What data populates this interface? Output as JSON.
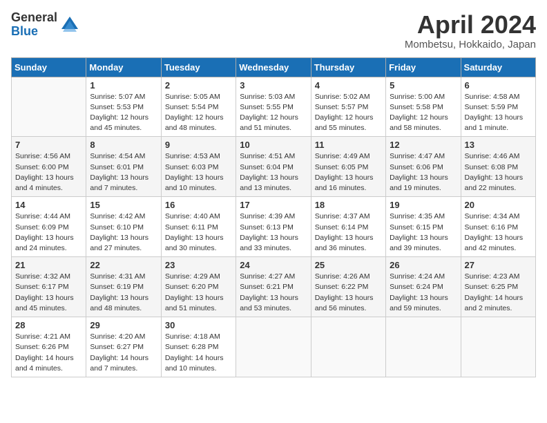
{
  "header": {
    "logo_general": "General",
    "logo_blue": "Blue",
    "month_title": "April 2024",
    "location": "Mombetsu, Hokkaido, Japan"
  },
  "calendar": {
    "days_of_week": [
      "Sunday",
      "Monday",
      "Tuesday",
      "Wednesday",
      "Thursday",
      "Friday",
      "Saturday"
    ],
    "weeks": [
      [
        {
          "day": "",
          "info": ""
        },
        {
          "day": "1",
          "info": "Sunrise: 5:07 AM\nSunset: 5:53 PM\nDaylight: 12 hours\nand 45 minutes."
        },
        {
          "day": "2",
          "info": "Sunrise: 5:05 AM\nSunset: 5:54 PM\nDaylight: 12 hours\nand 48 minutes."
        },
        {
          "day": "3",
          "info": "Sunrise: 5:03 AM\nSunset: 5:55 PM\nDaylight: 12 hours\nand 51 minutes."
        },
        {
          "day": "4",
          "info": "Sunrise: 5:02 AM\nSunset: 5:57 PM\nDaylight: 12 hours\nand 55 minutes."
        },
        {
          "day": "5",
          "info": "Sunrise: 5:00 AM\nSunset: 5:58 PM\nDaylight: 12 hours\nand 58 minutes."
        },
        {
          "day": "6",
          "info": "Sunrise: 4:58 AM\nSunset: 5:59 PM\nDaylight: 13 hours\nand 1 minute."
        }
      ],
      [
        {
          "day": "7",
          "info": "Sunrise: 4:56 AM\nSunset: 6:00 PM\nDaylight: 13 hours\nand 4 minutes."
        },
        {
          "day": "8",
          "info": "Sunrise: 4:54 AM\nSunset: 6:01 PM\nDaylight: 13 hours\nand 7 minutes."
        },
        {
          "day": "9",
          "info": "Sunrise: 4:53 AM\nSunset: 6:03 PM\nDaylight: 13 hours\nand 10 minutes."
        },
        {
          "day": "10",
          "info": "Sunrise: 4:51 AM\nSunset: 6:04 PM\nDaylight: 13 hours\nand 13 minutes."
        },
        {
          "day": "11",
          "info": "Sunrise: 4:49 AM\nSunset: 6:05 PM\nDaylight: 13 hours\nand 16 minutes."
        },
        {
          "day": "12",
          "info": "Sunrise: 4:47 AM\nSunset: 6:06 PM\nDaylight: 13 hours\nand 19 minutes."
        },
        {
          "day": "13",
          "info": "Sunrise: 4:46 AM\nSunset: 6:08 PM\nDaylight: 13 hours\nand 22 minutes."
        }
      ],
      [
        {
          "day": "14",
          "info": "Sunrise: 4:44 AM\nSunset: 6:09 PM\nDaylight: 13 hours\nand 24 minutes."
        },
        {
          "day": "15",
          "info": "Sunrise: 4:42 AM\nSunset: 6:10 PM\nDaylight: 13 hours\nand 27 minutes."
        },
        {
          "day": "16",
          "info": "Sunrise: 4:40 AM\nSunset: 6:11 PM\nDaylight: 13 hours\nand 30 minutes."
        },
        {
          "day": "17",
          "info": "Sunrise: 4:39 AM\nSunset: 6:13 PM\nDaylight: 13 hours\nand 33 minutes."
        },
        {
          "day": "18",
          "info": "Sunrise: 4:37 AM\nSunset: 6:14 PM\nDaylight: 13 hours\nand 36 minutes."
        },
        {
          "day": "19",
          "info": "Sunrise: 4:35 AM\nSunset: 6:15 PM\nDaylight: 13 hours\nand 39 minutes."
        },
        {
          "day": "20",
          "info": "Sunrise: 4:34 AM\nSunset: 6:16 PM\nDaylight: 13 hours\nand 42 minutes."
        }
      ],
      [
        {
          "day": "21",
          "info": "Sunrise: 4:32 AM\nSunset: 6:17 PM\nDaylight: 13 hours\nand 45 minutes."
        },
        {
          "day": "22",
          "info": "Sunrise: 4:31 AM\nSunset: 6:19 PM\nDaylight: 13 hours\nand 48 minutes."
        },
        {
          "day": "23",
          "info": "Sunrise: 4:29 AM\nSunset: 6:20 PM\nDaylight: 13 hours\nand 51 minutes."
        },
        {
          "day": "24",
          "info": "Sunrise: 4:27 AM\nSunset: 6:21 PM\nDaylight: 13 hours\nand 53 minutes."
        },
        {
          "day": "25",
          "info": "Sunrise: 4:26 AM\nSunset: 6:22 PM\nDaylight: 13 hours\nand 56 minutes."
        },
        {
          "day": "26",
          "info": "Sunrise: 4:24 AM\nSunset: 6:24 PM\nDaylight: 13 hours\nand 59 minutes."
        },
        {
          "day": "27",
          "info": "Sunrise: 4:23 AM\nSunset: 6:25 PM\nDaylight: 14 hours\nand 2 minutes."
        }
      ],
      [
        {
          "day": "28",
          "info": "Sunrise: 4:21 AM\nSunset: 6:26 PM\nDaylight: 14 hours\nand 4 minutes."
        },
        {
          "day": "29",
          "info": "Sunrise: 4:20 AM\nSunset: 6:27 PM\nDaylight: 14 hours\nand 7 minutes."
        },
        {
          "day": "30",
          "info": "Sunrise: 4:18 AM\nSunset: 6:28 PM\nDaylight: 14 hours\nand 10 minutes."
        },
        {
          "day": "",
          "info": ""
        },
        {
          "day": "",
          "info": ""
        },
        {
          "day": "",
          "info": ""
        },
        {
          "day": "",
          "info": ""
        }
      ]
    ]
  }
}
